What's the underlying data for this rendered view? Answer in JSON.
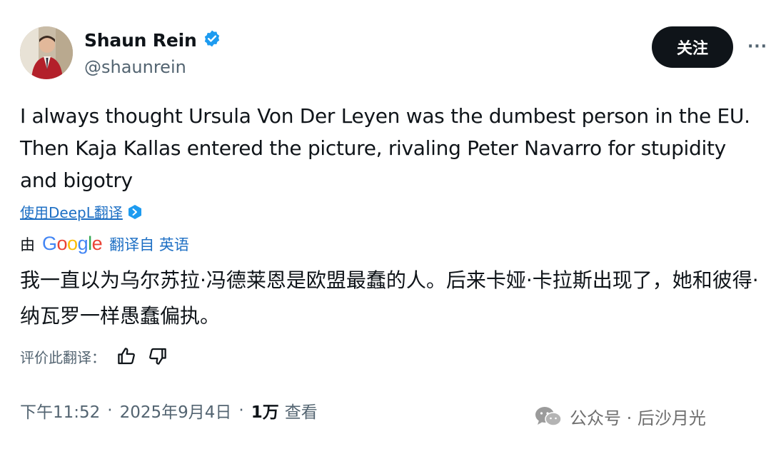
{
  "user": {
    "name": "Shaun Rein",
    "handle": "@shaunrein",
    "verified": true
  },
  "actions": {
    "follow_label": "关注",
    "more_label": "···"
  },
  "tweet": {
    "text": "I always thought Ursula Von Der Leyen was the dumbest person in the EU. Then Kaja Kallas entered the picture, rivaling Peter Navarro for stupidity and bigotry"
  },
  "deepl": {
    "link_label": "使用DeepL翻译"
  },
  "translation": {
    "by_label": "由",
    "provider": "Google",
    "translated_from": "翻译自 英语",
    "text": "我一直以为乌尔苏拉·冯德莱恩是欧盟最蠢的人。后来卡娅·卡拉斯出现了，她和彼得·纳瓦罗一样愚蠢偏执。",
    "rate_label": "评价此翻译："
  },
  "meta": {
    "time": "下午11:52",
    "sep1": "·",
    "date": "2025年9月4日",
    "sep2": "·",
    "views_count": "1万",
    "views_label": "查看"
  },
  "watermark": {
    "text": "公众号 · 后沙月光"
  },
  "colors": {
    "verified_badge": "#1d9bf0",
    "link": "#1d6fc4",
    "follow_bg": "#0f1419",
    "secondary_text": "#536471"
  }
}
